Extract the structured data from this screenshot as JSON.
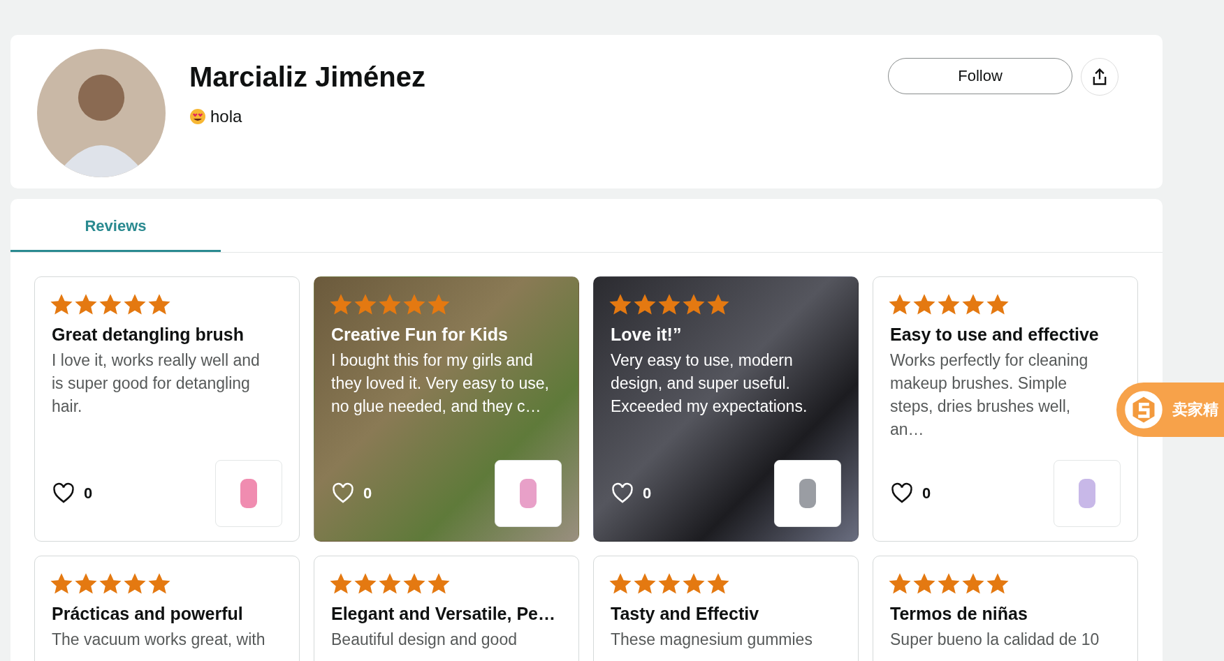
{
  "profile": {
    "name": "Marcializ Jiménez",
    "bio": "hola",
    "follow_label": "Follow"
  },
  "tabs": [
    {
      "label": "Reviews",
      "selected": true
    }
  ],
  "reviews": [
    {
      "kind": "plain",
      "stars": 5,
      "title": "Great detangling brush",
      "body": "I love it, works really well and is super good for detangling hair.",
      "likes": "0"
    },
    {
      "kind": "photo",
      "stars": 5,
      "title": "Creative Fun for Kids",
      "body": "I bought this for my girls and they loved it. Very easy to use, no glue needed, and they c…",
      "likes": "0"
    },
    {
      "kind": "photo",
      "stars": 5,
      "title": "Love it!”",
      "body": "Very easy to use, modern design, and super useful. Exceeded my expectations.",
      "likes": "0"
    },
    {
      "kind": "plain",
      "stars": 5,
      "title": "Easy to use and effective",
      "body": "Works perfectly for cleaning makeup brushes. Simple steps, dries brushes well, an…",
      "likes": "0"
    },
    {
      "kind": "plain",
      "stars": 5,
      "title": "Prácticas and powerful",
      "body": "The vacuum works great, with"
    },
    {
      "kind": "plain",
      "stars": 5,
      "title": "Elegant and Versatile, Pe…",
      "body": "Beautiful design and good"
    },
    {
      "kind": "plain",
      "stars": 5,
      "title": "Tasty and Effectiv",
      "body": "These magnesium gummies"
    },
    {
      "kind": "plain",
      "stars": 5,
      "title": "Termos de niñas",
      "body": "Super bueno la calidad de 10"
    }
  ],
  "extension_badge": {
    "label": "卖家精"
  }
}
